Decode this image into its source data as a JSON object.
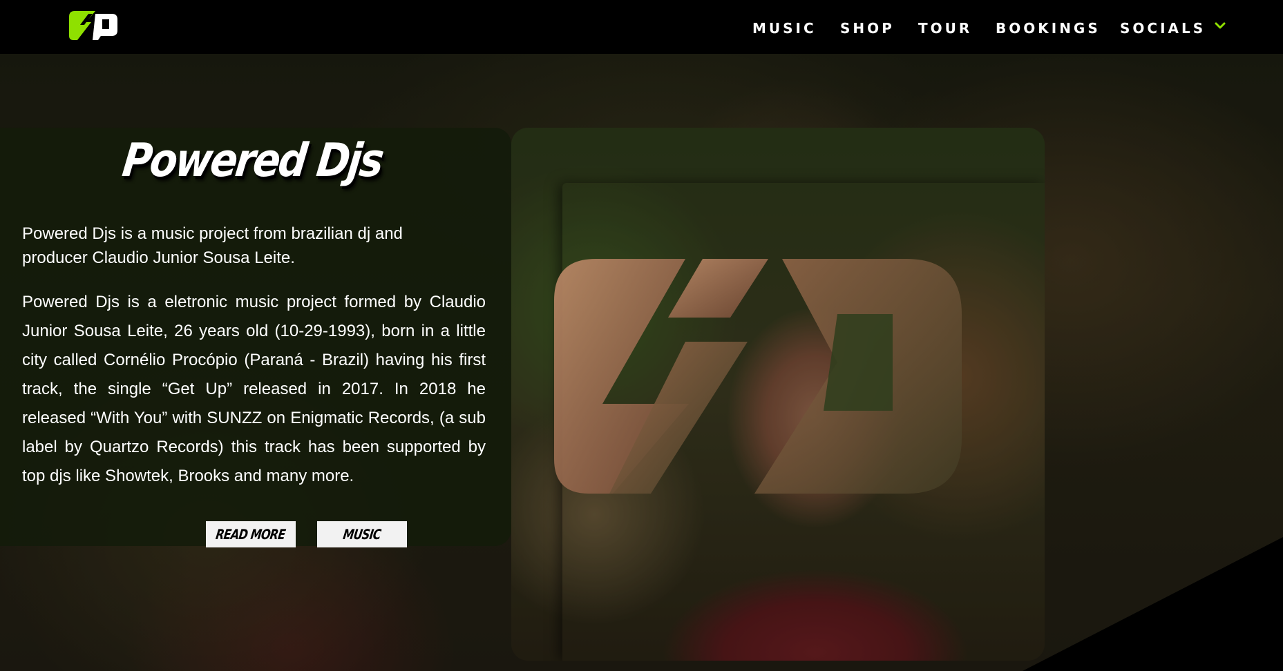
{
  "header": {
    "logo_alt": "Powered Djs logo",
    "nav": [
      {
        "label": "MUSIC"
      },
      {
        "label": "SHOP"
      },
      {
        "label": "TOUR"
      },
      {
        "label": "BOOKINGS"
      },
      {
        "label": "SOCIALS"
      }
    ],
    "dropdown_icon": "chevron-down-icon"
  },
  "card": {
    "title": "Powered Djs",
    "intro": "Powered Djs is a music project from brazilian dj and producer Claudio Junior Sousa Leite.",
    "bio": "Powered Djs is a eletronic music project formed by Claudio Junior Sousa Leite, 26 years old (10-29-1993), born in a little city called Cornélio Procópio (Paraná - Brazil) having his first track, the single “Get Up” released in 2017. In 2018 he released “With You” with SUNZZ on Enigmatic Records, (a sub label by Quartzo Records) this track has been supported by top djs like Showtek, Brooks and many more.",
    "buttons": {
      "read_more": "READ MORE",
      "music": "MUSIC"
    }
  },
  "colors": {
    "accent": "#8fe000",
    "header_bg": "#000000",
    "card_bg": "#131b0a",
    "button_bg": "#f2f2f2"
  }
}
